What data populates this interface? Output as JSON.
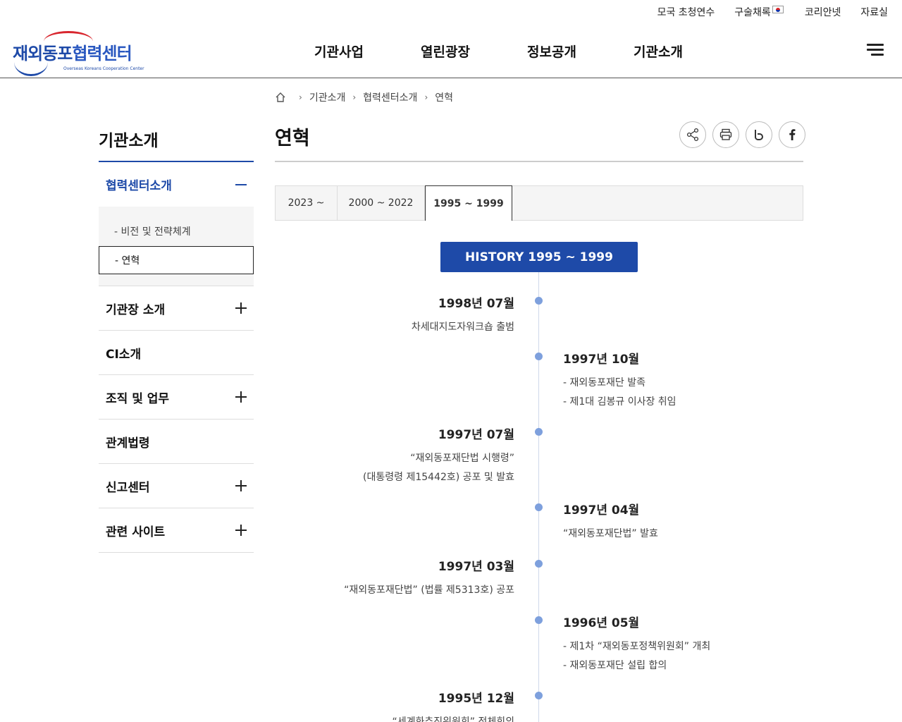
{
  "util_links": [
    "모국 초청연수",
    "구술채록",
    "코리안넷",
    "자료실"
  ],
  "logo": {
    "ko_main": "재외동포",
    "ko_sub": "협력센터",
    "en": "Overseas Koreans Cooperation Center"
  },
  "gnb": [
    "기관사업",
    "열린광장",
    "정보공개",
    "기관소개"
  ],
  "breadcrumb": [
    "기관소개",
    "협력센터소개",
    "연혁"
  ],
  "lnb": {
    "title": "기관소개",
    "active_group": "협력센터소개",
    "sub_items": [
      "비전 및 전략체계",
      "연혁"
    ],
    "groups": [
      "기관장 소개",
      "CI소개",
      "조직 및 업무",
      "관계법령",
      "신고센터",
      "관련 사이트"
    ]
  },
  "page_title": "연혁",
  "tabs": [
    "2023 ~",
    "2000 ~ 2022",
    "1995 ~ 1999"
  ],
  "history_badge": "HISTORY 1995 ~ 1999",
  "events": [
    {
      "date": "1998년 07월",
      "lines": [
        "차세대지도자워크숍 출범"
      ]
    },
    {
      "date": "1997년 10월",
      "lines": [
        "- 재외동포재단 발족",
        "- 제1대 김봉규 이사장 취임"
      ]
    },
    {
      "date": "1997년 07월",
      "lines": [
        "“재외동포재단법 시행령”",
        "(대통령령 제15442호) 공포 및 발효"
      ]
    },
    {
      "date": "1997년 04월",
      "lines": [
        "“재외동포재단법” 발효"
      ]
    },
    {
      "date": "1997년 03월",
      "lines": [
        "“재외동포재단법” (법률 제5313호) 공포"
      ]
    },
    {
      "date": "1996년 05월",
      "lines": [
        "- 제1차 “재외동포정책위원회” 개최",
        "- 재외동포재단 설립 합의"
      ]
    },
    {
      "date": "1995년 12월",
      "lines": [
        "“세계화추진위원회” 전체회의"
      ]
    }
  ],
  "colors": {
    "brand_blue": "#1e4aa8",
    "timeline_dot": "#7ea0dd",
    "logo_red": "#d8262e"
  },
  "icons": [
    "home-icon",
    "share-icon",
    "print-icon",
    "blog-icon",
    "facebook-icon",
    "hamburger-menu-icon"
  ]
}
